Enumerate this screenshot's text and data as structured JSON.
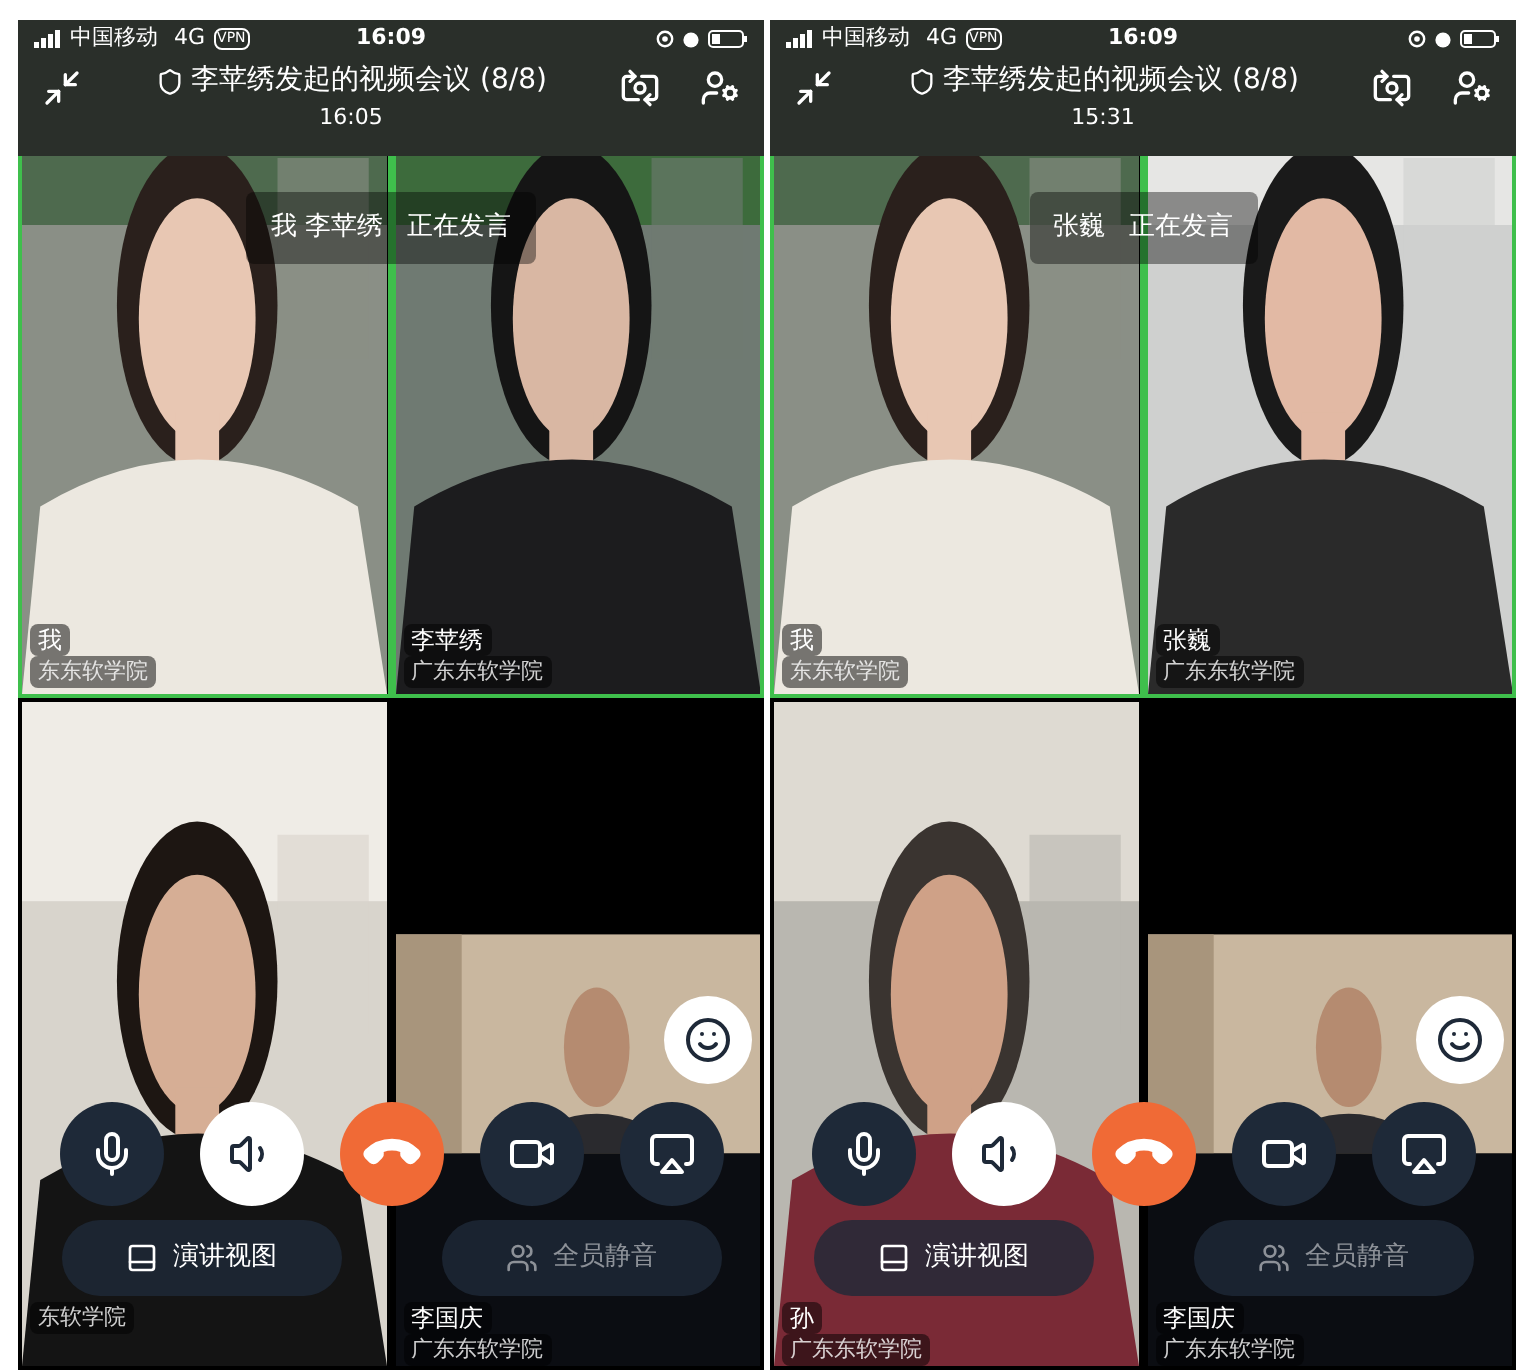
{
  "screens": [
    {
      "status": {
        "carrier": "中国移动",
        "network": "4G",
        "vpn": "VPN",
        "time": "16:09"
      },
      "title": "李苹绣发起的视频会议 (8/8)",
      "elapsed": "16:05",
      "toast": {
        "name": "我 李苹绣",
        "text": "正在发言"
      },
      "tiles": [
        {
          "name": "我",
          "org": "东东软学院",
          "speaking": true
        },
        {
          "name": "李苹绣",
          "org": "广东东软学院",
          "speaking": true
        },
        {
          "org": "东软学院",
          "speaking": false
        },
        {
          "name": "李国庆",
          "org": "广东东软学院",
          "speaking": false
        }
      ],
      "controls": [
        {
          "kind": "mic",
          "on": false
        },
        {
          "kind": "speaker",
          "on": true
        },
        {
          "kind": "hangup",
          "on": true
        },
        {
          "kind": "camera",
          "on": false
        },
        {
          "kind": "share",
          "on": false
        }
      ],
      "pills": [
        {
          "kind": "view",
          "label": "演讲视图",
          "disabled": false
        },
        {
          "kind": "mute",
          "label": "全员静音",
          "disabled": true
        }
      ]
    },
    {
      "status": {
        "carrier": "中国移动",
        "network": "4G",
        "vpn": "VPN",
        "time": "16:09"
      },
      "title": "李苹绣发起的视频会议 (8/8)",
      "elapsed": "15:31",
      "toast": {
        "name": "张巍",
        "text": "正在发言"
      },
      "tiles": [
        {
          "name": "我",
          "org": "东东软学院",
          "speaking": true
        },
        {
          "name": "张巍",
          "org": "广东东软学院",
          "speaking": true
        },
        {
          "name": "孙",
          "org": "广东东软学院",
          "speaking": false
        },
        {
          "name": "李国庆",
          "org": "广东东软学院",
          "speaking": false
        }
      ],
      "controls": [
        {
          "kind": "mic",
          "on": false
        },
        {
          "kind": "speaker",
          "on": true
        },
        {
          "kind": "hangup",
          "on": true
        },
        {
          "kind": "camera",
          "on": false
        },
        {
          "kind": "share",
          "on": false
        }
      ],
      "pills": [
        {
          "kind": "view",
          "label": "演讲视图",
          "disabled": false
        },
        {
          "kind": "mute",
          "label": "全员静音",
          "disabled": true
        }
      ]
    }
  ]
}
